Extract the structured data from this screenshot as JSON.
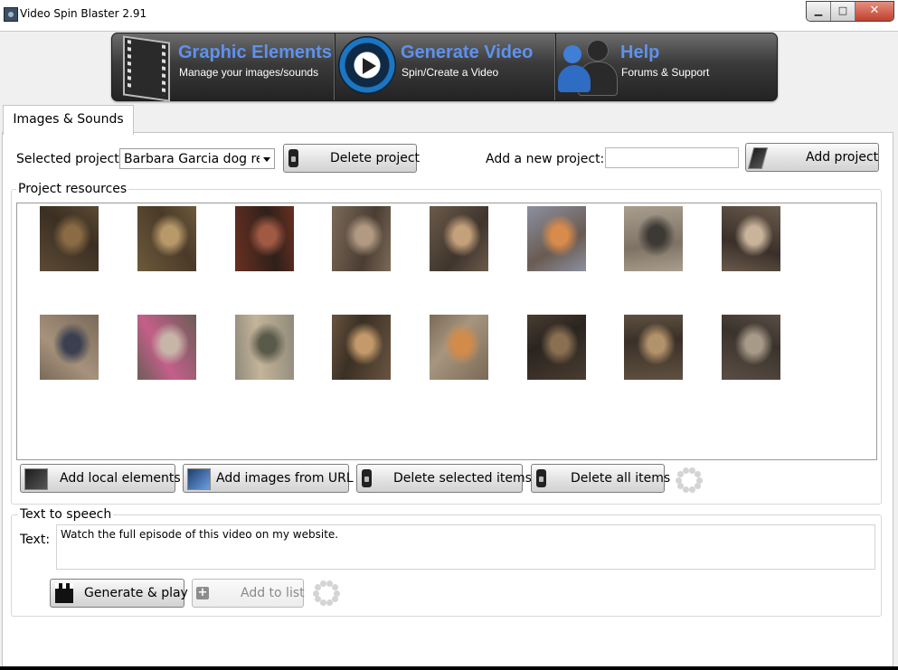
{
  "window": {
    "title": "Video Spin Blaster 2.91",
    "controls": {
      "minimize": "▁",
      "maximize": "□",
      "close": "✕"
    }
  },
  "nav": {
    "items": [
      {
        "title": "Graphic Elements",
        "subtitle": "Manage your images/sounds",
        "icon": "film-strip-icon"
      },
      {
        "title": "Generate Video",
        "subtitle": "Spin/Create a Video",
        "icon": "play-disc-icon"
      },
      {
        "title": "Help",
        "subtitle": "Forums & Support",
        "icon": "users-icon"
      }
    ]
  },
  "tabs": [
    {
      "label": "Images & Sounds",
      "active": true
    }
  ],
  "project": {
    "selected_label": "Selected project:",
    "selected_value": "Barbara Garcia dog reun",
    "delete_label": "Delete project",
    "new_label": "Add a new project:",
    "new_value": "",
    "add_label": "Add project"
  },
  "resources": {
    "label": "Project resources",
    "thumbnails": [
      {
        "row": 1,
        "col": 1,
        "colors": [
          "#5b4a35",
          "#8a6b45",
          "#3b2f22"
        ]
      },
      {
        "row": 1,
        "col": 2,
        "colors": [
          "#6d5a3c",
          "#b89a6a",
          "#4a3a28"
        ]
      },
      {
        "row": 1,
        "col": 3,
        "colors": [
          "#6a2f22",
          "#a05a44",
          "#2e201a"
        ]
      },
      {
        "row": 1,
        "col": 4,
        "colors": [
          "#7b6a58",
          "#b29a82",
          "#4a3d33"
        ]
      },
      {
        "row": 1,
        "col": 5,
        "colors": [
          "#6b5a4a",
          "#c4a17a",
          "#3f352d"
        ]
      },
      {
        "row": 1,
        "col": 6,
        "colors": [
          "#8b90a0",
          "#d98b4b",
          "#6a5b52"
        ]
      },
      {
        "row": 1,
        "col": 7,
        "colors": [
          "#a99e8e",
          "#3d3a36",
          "#7e7265"
        ]
      },
      {
        "row": 1,
        "col": 8,
        "colors": [
          "#6a5a4d",
          "#c9b39a",
          "#3a3029"
        ]
      },
      {
        "row": 2,
        "col": 1,
        "colors": [
          "#7a6a5a",
          "#3a4050",
          "#a6927c"
        ]
      },
      {
        "row": 2,
        "col": 2,
        "colors": [
          "#6b5e57",
          "#c7b6a8",
          "#c45f8a"
        ]
      },
      {
        "row": 2,
        "col": 3,
        "colors": [
          "#8f8a7a",
          "#5a5a4a",
          "#c4b49a"
        ]
      },
      {
        "row": 2,
        "col": 4,
        "colors": [
          "#6a5440",
          "#c49a6a",
          "#3a3024"
        ]
      },
      {
        "row": 2,
        "col": 5,
        "colors": [
          "#7a6a55",
          "#d28b4a",
          "#a69680"
        ]
      },
      {
        "row": 2,
        "col": 6,
        "colors": [
          "#4a3d30",
          "#8a7050",
          "#2a2420"
        ]
      },
      {
        "row": 2,
        "col": 7,
        "colors": [
          "#5f5040",
          "#b2926a",
          "#3a3028"
        ]
      },
      {
        "row": 2,
        "col": 8,
        "colors": [
          "#5a4e44",
          "#a89a88",
          "#3a332d"
        ]
      }
    ],
    "buttons": {
      "add_local": "Add local elements",
      "add_url": "Add images from URL",
      "delete_selected": "Delete selected items",
      "delete_all": "Delete all items"
    }
  },
  "tts": {
    "label": "Text to speech",
    "text_label": "Text:",
    "text_value": "Watch the full episode of this video on my website.",
    "generate_label": "Generate & play",
    "add_label": "Add to list"
  }
}
